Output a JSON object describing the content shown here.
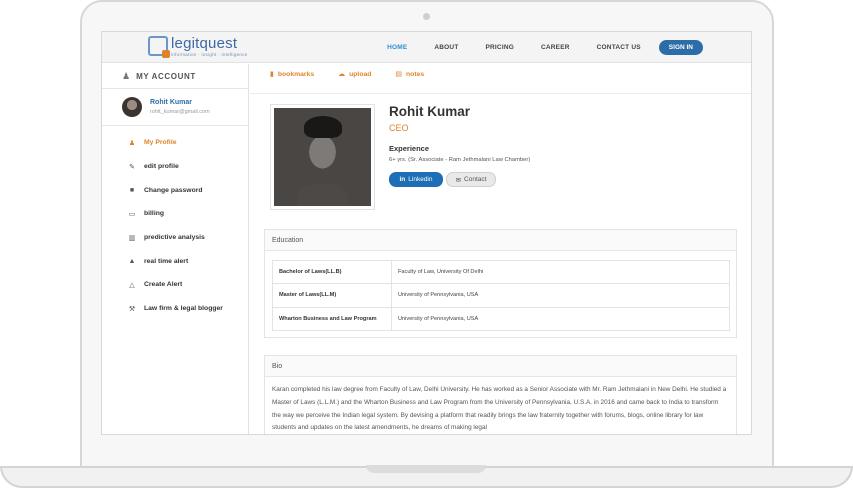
{
  "brand": {
    "name": "legitquest",
    "tagline": "information · insight · intelligence"
  },
  "nav": {
    "links": [
      "HOME",
      "ABOUT",
      "PRICING",
      "CAREER",
      "CONTACT US"
    ],
    "active": "HOME",
    "signin_label": "SIGN IN"
  },
  "sidebar": {
    "title": "MY ACCOUNT",
    "user": {
      "name": "Rohit Kumar",
      "email": "rohit_kumar@gmail.com"
    },
    "items": [
      {
        "label": "My Profile",
        "icon": "user-icon"
      },
      {
        "label": "edit profile",
        "icon": "edit-icon"
      },
      {
        "label": "Change password",
        "icon": "lock-icon"
      },
      {
        "label": "billing",
        "icon": "credit-card-icon"
      },
      {
        "label": "predictive analysis",
        "icon": "chart-icon"
      },
      {
        "label": "real time alert",
        "icon": "bell-icon"
      },
      {
        "label": "Create Alert",
        "icon": "bell-outline-icon"
      },
      {
        "label": "Law firm & legal blogger",
        "icon": "gavel-icon"
      }
    ]
  },
  "tabs": [
    "bookmarks",
    "upload",
    "notes"
  ],
  "profile": {
    "name": "Rohit Kumar",
    "role": "CEO",
    "experience_label": "Experience",
    "experience_value": "6+ yrs. (Sr. Associate - Ram Jethmalani Law Chamber)",
    "linkedin_label": "Linkedin",
    "contact_label": "Contact"
  },
  "education": {
    "title": "Education",
    "rows": [
      {
        "degree": "Bachelor of Laws(LL.B)",
        "institution": "Faculty of Law, University Of Delhi"
      },
      {
        "degree": "Master of Laws(LL.M)",
        "institution": "University of Pennsylvania, USA"
      },
      {
        "degree": "Wharton Business and Law Program",
        "institution": "University of Pennsylvania, USA"
      }
    ]
  },
  "bio": {
    "title": "Bio",
    "text": "Karan completed his law degree from Faculty of Law, Delhi University. He has worked as a Senior Associate with Mr. Ram Jethmalani in New Delhi. He studied a Master of Laws (L.L.M.) and the Wharton Business and Law Program from the University of Pennsylvania, U.S.A. in 2016 and came back to India to transform the way we perceive the Indian legal system. By devising a platform that readily brings the law fraternity together with forums, blogs, online library for law students and updates on the latest amendments, he dreams of making legal"
  },
  "colors": {
    "accent": "#e0842b",
    "primary": "#2c6da8",
    "linkedin": "#1c6fb5"
  }
}
